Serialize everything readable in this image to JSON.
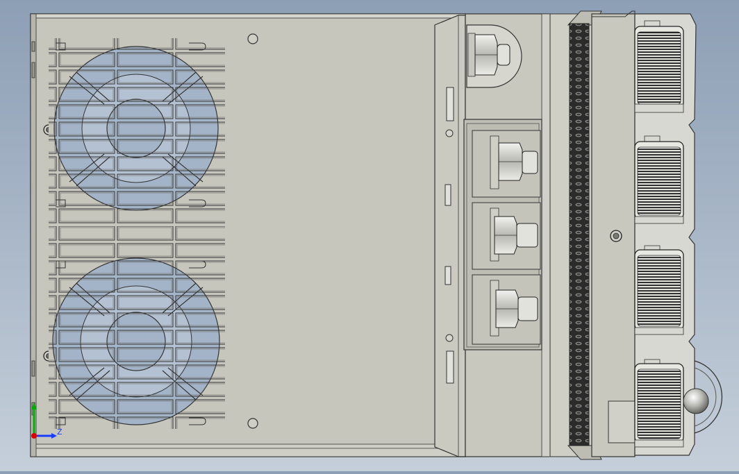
{
  "viewport": {
    "background_top": "#8d9fb5",
    "background_bottom": "#c5cfda",
    "body_color": "#c6c6bc",
    "edge_color": "#3c3c3c",
    "fan_blue": "#a4b4c8",
    "metal_color": "#d8d8d2"
  },
  "triad": {
    "axis_label": "Z",
    "x_color": "#e00000",
    "y_color": "#00b000",
    "z_color": "#1a3cff"
  },
  "parts": {
    "fan_count": 2,
    "terminal_bolt_count": 3,
    "connector_count": 4
  }
}
